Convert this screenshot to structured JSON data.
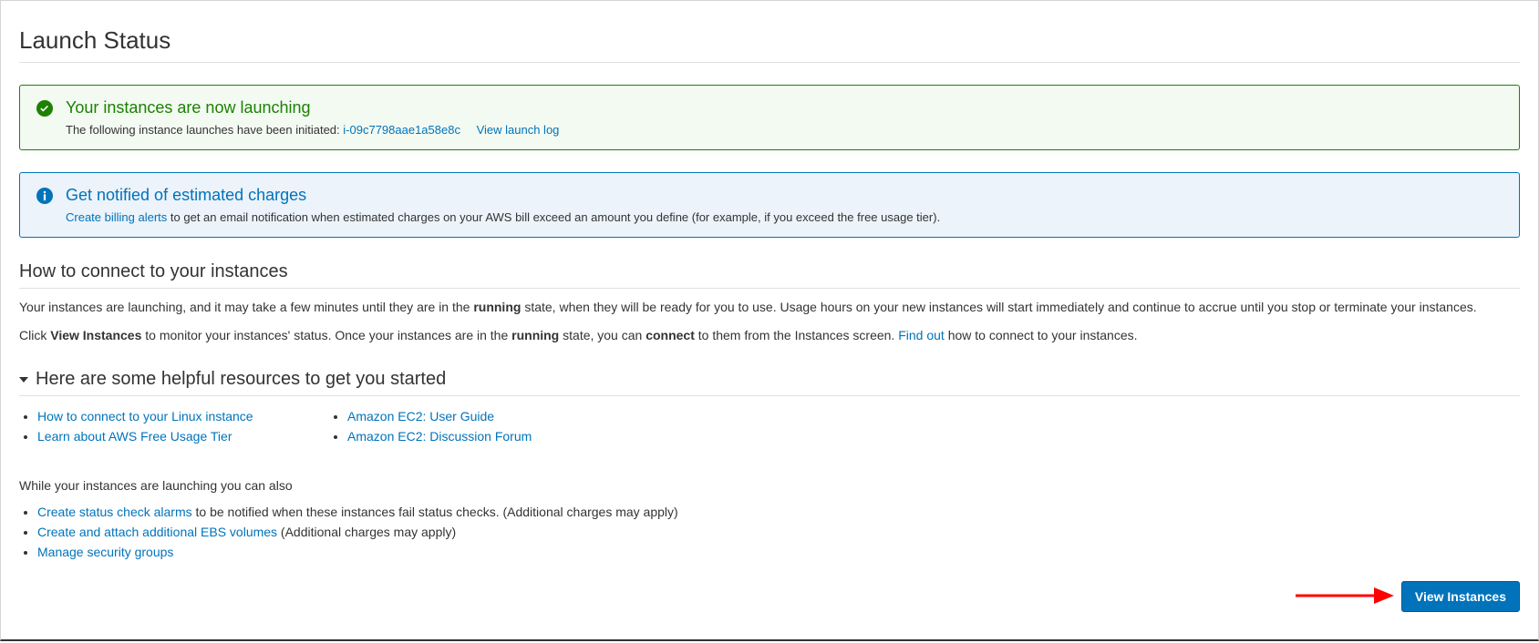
{
  "page_title": "Launch Status",
  "success_box": {
    "heading": "Your instances are now launching",
    "prefix_text": "The following instance launches have been initiated:",
    "instance_id": "i-09c7798aae1a58e8c",
    "view_log_link": "View launch log"
  },
  "info_box": {
    "heading": "Get notified of estimated charges",
    "link_text": "Create billing alerts",
    "following_text": "to get an email notification when estimated charges on your AWS bill exceed an amount you define (for example, if you exceed the free usage tier)."
  },
  "connect_section": {
    "title": "How to connect to your instances",
    "p1_pre": "Your instances are launching, and it may take a few minutes until they are in the ",
    "p1_bold1": "running",
    "p1_post": " state, when they will be ready for you to use. Usage hours on your new instances will start immediately and continue to accrue until you stop or terminate your instances.",
    "p2_a": "Click ",
    "p2_bold1": "View Instances",
    "p2_b": " to monitor your instances' status. Once your instances are in the ",
    "p2_bold2": "running",
    "p2_c": " state, you can ",
    "p2_bold3": "connect",
    "p2_d": " to them from the Instances screen. ",
    "p2_link": "Find out",
    "p2_e": " how to connect to your instances."
  },
  "resources_section": {
    "title": "Here are some helpful resources to get you started",
    "col1": [
      "How to connect to your Linux instance",
      "Learn about AWS Free Usage Tier"
    ],
    "col2": [
      "Amazon EC2: User Guide",
      "Amazon EC2: Discussion Forum"
    ]
  },
  "while_launching": {
    "intro": "While your instances are launching you can also",
    "items": [
      {
        "link": "Create status check alarms",
        "rest": " to be notified when these instances fail status checks. (Additional charges may apply)"
      },
      {
        "link": "Create and attach additional EBS volumes",
        "rest": " (Additional charges may apply)"
      },
      {
        "link": "Manage security groups",
        "rest": ""
      }
    ]
  },
  "view_instances_button": "View Instances"
}
